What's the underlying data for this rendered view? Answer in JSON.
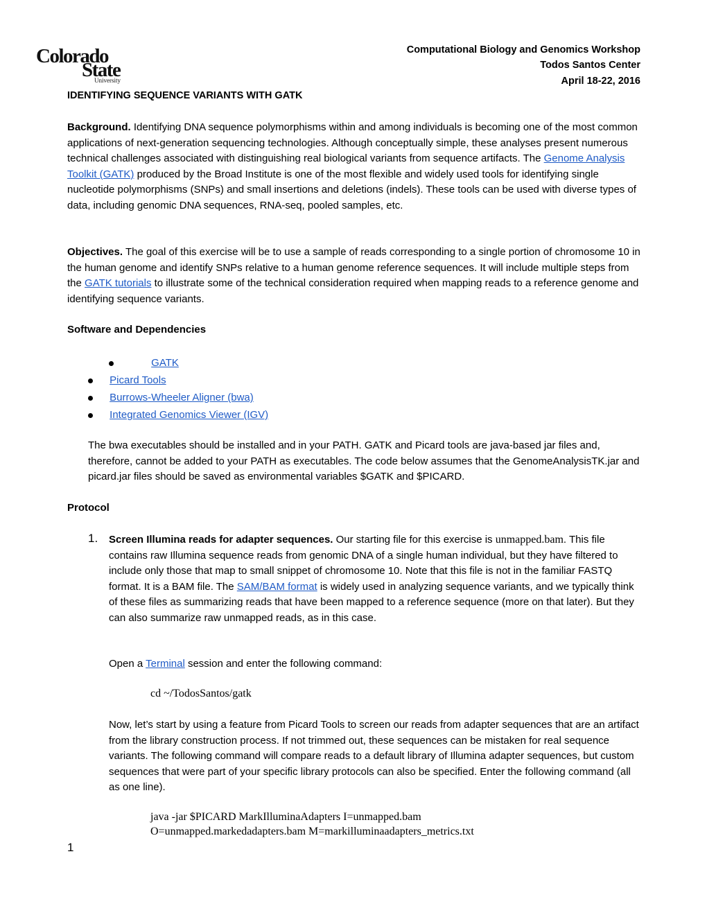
{
  "logo": {
    "line1": "Colorado",
    "line2": "State",
    "line3": "University"
  },
  "header": {
    "line1": "Computational Biology and Genomics Workshop",
    "line2": "Todos Santos Center",
    "line3": "April 18-22, 2016"
  },
  "title": "IDENTIFYING SEQUENCE VARIANTS WITH GATK",
  "background": {
    "heading": "Background.",
    "text1": " Identifying DNA sequence polymorphisms within and among individuals is becoming one of the most common applications of next-generation sequencing technologies. Although conceptually simple, these analyses present numerous technical challenges associated with distinguishing real biological variants from sequence artifacts. The ",
    "link": "Genome Analysis Toolkit (GATK)",
    "text2": " produced by the Broad Institute is one of the most flexible and widely used tools for identifying single nucleotide polymorphisms (SNPs) and small insertions and deletions (indels). These tools can be used with diverse types of data, including genomic DNA sequences, RNA-seq, pooled samples, etc."
  },
  "objectives": {
    "heading": "Objectives.",
    "text1": " The goal of this exercise will be to use a sample of reads corresponding to a single portion of chromosome 10 in the human genome and identify SNPs relative to a human genome reference sequences. It will include multiple steps from the ",
    "link": "GATK tutorials",
    "text2": " to illustrate some of the technical consideration required when mapping reads to a reference genome and identifying sequence variants."
  },
  "software": {
    "heading": "Software and Dependencies",
    "items": [
      "GATK",
      "Picard Tools",
      "Burrows-Wheeler Aligner (bwa)",
      "Integrated Genomics Viewer (IGV)"
    ],
    "note": "The bwa executables should be installed and in your PATH. GATK and Picard tools are java-based jar files and, therefore, cannot be added to your PATH as executables. The code below assumes that the GenomeAnalysisTK.jar and picard.jar files should be saved as environmental variables $GATK and $PICARD."
  },
  "protocol": {
    "heading": "Protocol",
    "step1": {
      "number": "1.",
      "heading": "Screen Illumina reads for adapter sequences.",
      "text1": " Our starting file for this exercise is ",
      "file": "unmapped.bam",
      "text2": ". This file contains raw Illumina sequence reads from genomic DNA of a single human individual, but they have filtered to include only those that map to small snippet of chromosome 10. Note that this file is not in the familiar FASTQ format. It is a BAM file. The ",
      "link": "SAM/BAM format",
      "text3": " is widely used in analyzing sequence variants, and we typically think of these files as summarizing reads that have been mapped to a reference sequence (more on that later). But they can also summarize raw unmapped reads, as in this case."
    },
    "terminal": {
      "text1": "Open a ",
      "link": "Terminal",
      "text2": " session and enter the following command:"
    },
    "cmd1": "cd ~/TodosSantos/gatk",
    "picard_para": "Now, let’s start by using a feature from Picard Tools to screen our reads from adapter sequences that are an artifact from the library construction process. If not trimmed out, these sequences can be mistaken for real sequence variants. The following command will compare reads to a default library of Illumina adapter sequences, but custom sequences that were part of your specific library protocols can also be specified. Enter the following command (all as one line).",
    "cmd2_line1": "java -jar $PICARD MarkIlluminaAdapters I=unmapped.bam",
    "cmd2_line2": "O=unmapped.markedadapters.bam M=markilluminaadapters_metrics.txt"
  },
  "page_number": "1",
  "colors": {
    "link": "#1f5bc6",
    "text": "#000000"
  }
}
